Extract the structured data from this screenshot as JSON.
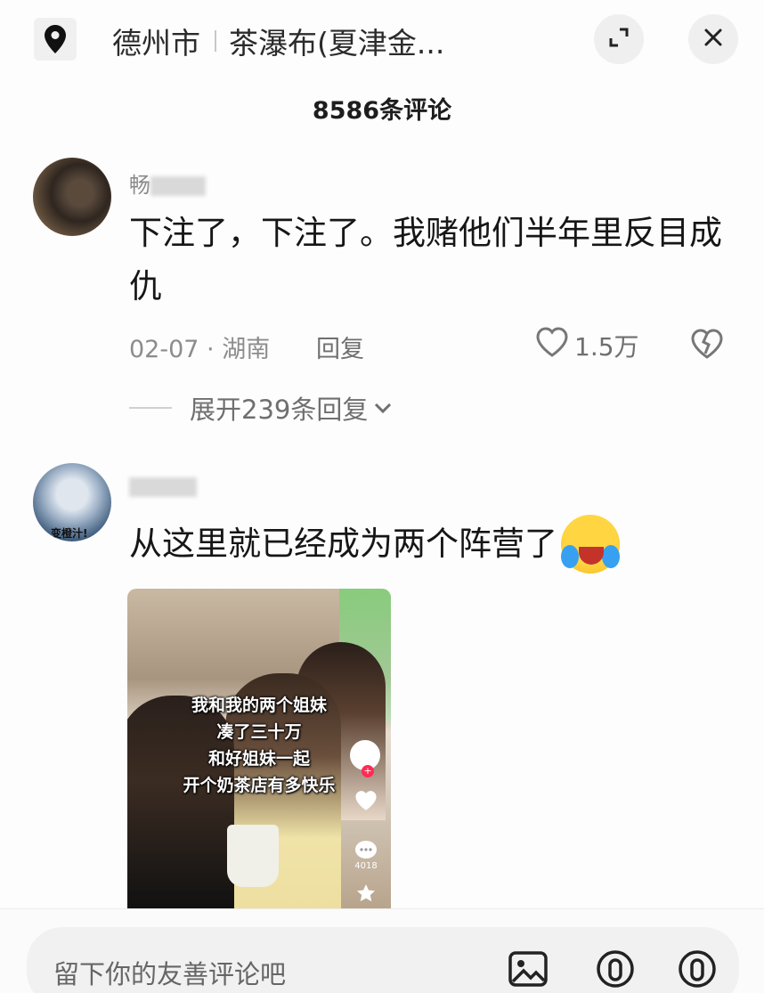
{
  "header": {
    "location_icon": "map-pin-icon",
    "city": "德州市",
    "place": "茶瀑布(夏津金...",
    "expand_icon": "expand-icon",
    "close_icon": "close-icon"
  },
  "comments_count_title": "8586条评论",
  "comments": [
    {
      "username": "畅",
      "text": "下注了，下注了。我赌他们半年里反目成仇",
      "date_location": "02-07 · 湖南",
      "reply_label": "回复",
      "likes": "1.5万",
      "expand_replies": "展开239条回复"
    },
    {
      "avatar_tag": "变橙汁!",
      "text": "从这里就已经成为两个阵营了",
      "emoji": "laughing-crying-emoji",
      "video": {
        "captions": [
          "我和我的两个姐妹",
          "凑了三十万",
          "和好姐妹一起",
          "开个奶茶店有多快乐"
        ],
        "comment_count": "4018"
      }
    }
  ],
  "input_bar": {
    "placeholder": "留下你的友善评论吧"
  },
  "colors": {
    "background": "#fdfdfd",
    "primary_text": "#161616",
    "secondary_text": "#8c8c8c",
    "accent_red": "#fe2c55"
  }
}
